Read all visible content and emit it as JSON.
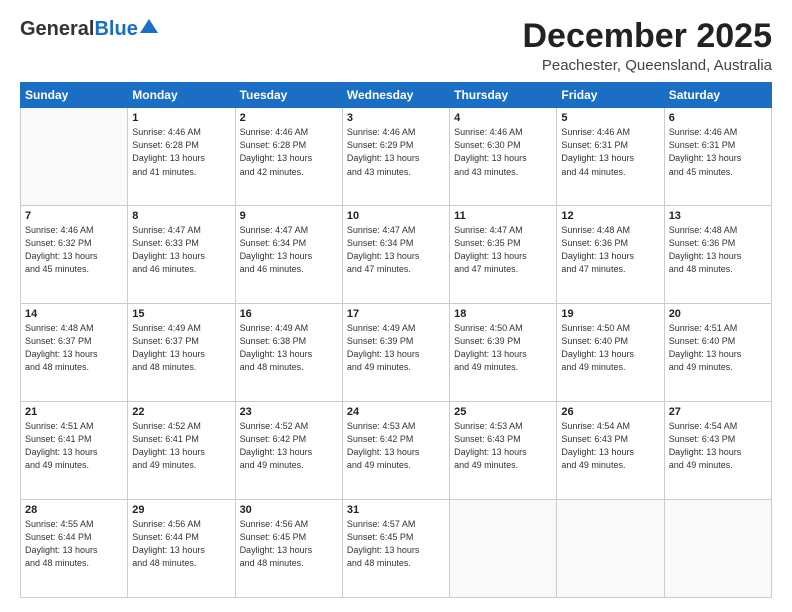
{
  "header": {
    "logo_general": "General",
    "logo_blue": "Blue",
    "month_title": "December 2025",
    "subtitle": "Peachester, Queensland, Australia"
  },
  "days_of_week": [
    "Sunday",
    "Monday",
    "Tuesday",
    "Wednesday",
    "Thursday",
    "Friday",
    "Saturday"
  ],
  "weeks": [
    [
      {
        "day": "",
        "info": ""
      },
      {
        "day": "1",
        "info": "Sunrise: 4:46 AM\nSunset: 6:28 PM\nDaylight: 13 hours\nand 41 minutes."
      },
      {
        "day": "2",
        "info": "Sunrise: 4:46 AM\nSunset: 6:28 PM\nDaylight: 13 hours\nand 42 minutes."
      },
      {
        "day": "3",
        "info": "Sunrise: 4:46 AM\nSunset: 6:29 PM\nDaylight: 13 hours\nand 43 minutes."
      },
      {
        "day": "4",
        "info": "Sunrise: 4:46 AM\nSunset: 6:30 PM\nDaylight: 13 hours\nand 43 minutes."
      },
      {
        "day": "5",
        "info": "Sunrise: 4:46 AM\nSunset: 6:31 PM\nDaylight: 13 hours\nand 44 minutes."
      },
      {
        "day": "6",
        "info": "Sunrise: 4:46 AM\nSunset: 6:31 PM\nDaylight: 13 hours\nand 45 minutes."
      }
    ],
    [
      {
        "day": "7",
        "info": "Sunrise: 4:46 AM\nSunset: 6:32 PM\nDaylight: 13 hours\nand 45 minutes."
      },
      {
        "day": "8",
        "info": "Sunrise: 4:47 AM\nSunset: 6:33 PM\nDaylight: 13 hours\nand 46 minutes."
      },
      {
        "day": "9",
        "info": "Sunrise: 4:47 AM\nSunset: 6:34 PM\nDaylight: 13 hours\nand 46 minutes."
      },
      {
        "day": "10",
        "info": "Sunrise: 4:47 AM\nSunset: 6:34 PM\nDaylight: 13 hours\nand 47 minutes."
      },
      {
        "day": "11",
        "info": "Sunrise: 4:47 AM\nSunset: 6:35 PM\nDaylight: 13 hours\nand 47 minutes."
      },
      {
        "day": "12",
        "info": "Sunrise: 4:48 AM\nSunset: 6:36 PM\nDaylight: 13 hours\nand 47 minutes."
      },
      {
        "day": "13",
        "info": "Sunrise: 4:48 AM\nSunset: 6:36 PM\nDaylight: 13 hours\nand 48 minutes."
      }
    ],
    [
      {
        "day": "14",
        "info": "Sunrise: 4:48 AM\nSunset: 6:37 PM\nDaylight: 13 hours\nand 48 minutes."
      },
      {
        "day": "15",
        "info": "Sunrise: 4:49 AM\nSunset: 6:37 PM\nDaylight: 13 hours\nand 48 minutes."
      },
      {
        "day": "16",
        "info": "Sunrise: 4:49 AM\nSunset: 6:38 PM\nDaylight: 13 hours\nand 48 minutes."
      },
      {
        "day": "17",
        "info": "Sunrise: 4:49 AM\nSunset: 6:39 PM\nDaylight: 13 hours\nand 49 minutes."
      },
      {
        "day": "18",
        "info": "Sunrise: 4:50 AM\nSunset: 6:39 PM\nDaylight: 13 hours\nand 49 minutes."
      },
      {
        "day": "19",
        "info": "Sunrise: 4:50 AM\nSunset: 6:40 PM\nDaylight: 13 hours\nand 49 minutes."
      },
      {
        "day": "20",
        "info": "Sunrise: 4:51 AM\nSunset: 6:40 PM\nDaylight: 13 hours\nand 49 minutes."
      }
    ],
    [
      {
        "day": "21",
        "info": "Sunrise: 4:51 AM\nSunset: 6:41 PM\nDaylight: 13 hours\nand 49 minutes."
      },
      {
        "day": "22",
        "info": "Sunrise: 4:52 AM\nSunset: 6:41 PM\nDaylight: 13 hours\nand 49 minutes."
      },
      {
        "day": "23",
        "info": "Sunrise: 4:52 AM\nSunset: 6:42 PM\nDaylight: 13 hours\nand 49 minutes."
      },
      {
        "day": "24",
        "info": "Sunrise: 4:53 AM\nSunset: 6:42 PM\nDaylight: 13 hours\nand 49 minutes."
      },
      {
        "day": "25",
        "info": "Sunrise: 4:53 AM\nSunset: 6:43 PM\nDaylight: 13 hours\nand 49 minutes."
      },
      {
        "day": "26",
        "info": "Sunrise: 4:54 AM\nSunset: 6:43 PM\nDaylight: 13 hours\nand 49 minutes."
      },
      {
        "day": "27",
        "info": "Sunrise: 4:54 AM\nSunset: 6:43 PM\nDaylight: 13 hours\nand 49 minutes."
      }
    ],
    [
      {
        "day": "28",
        "info": "Sunrise: 4:55 AM\nSunset: 6:44 PM\nDaylight: 13 hours\nand 48 minutes."
      },
      {
        "day": "29",
        "info": "Sunrise: 4:56 AM\nSunset: 6:44 PM\nDaylight: 13 hours\nand 48 minutes."
      },
      {
        "day": "30",
        "info": "Sunrise: 4:56 AM\nSunset: 6:45 PM\nDaylight: 13 hours\nand 48 minutes."
      },
      {
        "day": "31",
        "info": "Sunrise: 4:57 AM\nSunset: 6:45 PM\nDaylight: 13 hours\nand 48 minutes."
      },
      {
        "day": "",
        "info": ""
      },
      {
        "day": "",
        "info": ""
      },
      {
        "day": "",
        "info": ""
      }
    ]
  ]
}
